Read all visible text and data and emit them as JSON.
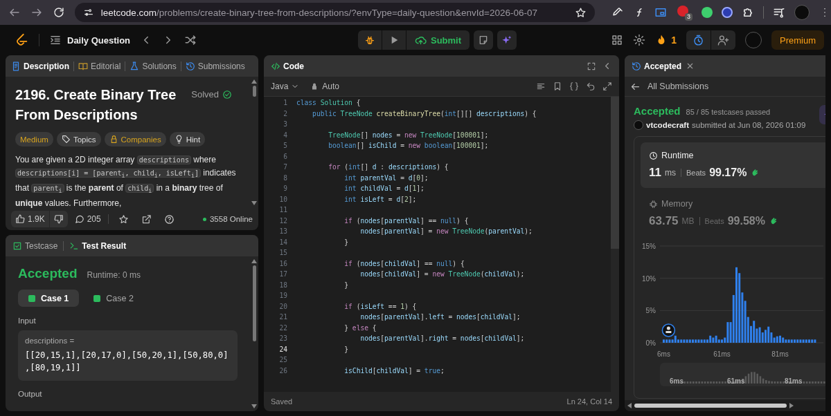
{
  "browser": {
    "url_host": "leetcode.com",
    "url_path": "/problems/create-binary-tree-from-descriptions/?envType=daily-question&envId=2026-06-07",
    "extension_badge": "3"
  },
  "header": {
    "title": "Daily Question",
    "submit": "Submit",
    "streak": "1",
    "premium": "Premium"
  },
  "description_panel": {
    "tabs": [
      {
        "label": "Description",
        "selected": true,
        "kind": "description"
      },
      {
        "label": "Editorial",
        "selected": false,
        "kind": "editorial"
      },
      {
        "label": "Solutions",
        "selected": false,
        "kind": "solutions"
      },
      {
        "label": "Submissions",
        "selected": false,
        "kind": "submissions"
      }
    ],
    "title": "2196. Create Binary Tree From Descriptions",
    "status": "Solved",
    "tags": [
      {
        "label": "Medium",
        "kind": "difficulty"
      },
      {
        "label": "Topics",
        "kind": "topics"
      },
      {
        "label": "Companies",
        "kind": "companies"
      },
      {
        "label": "Hint",
        "kind": "hint"
      }
    ],
    "body": [
      {
        "kind": "text",
        "text": "You are given a 2D integer array "
      },
      {
        "kind": "code",
        "text": "descriptions"
      },
      {
        "kind": "text",
        "text": " where "
      },
      {
        "kind": "code",
        "text": "descriptions[i] = [parent$_{i}$, child$_{i}$, isLeft$_{i}$]"
      },
      {
        "kind": "text",
        "text": " indicates that "
      },
      {
        "kind": "code",
        "text": "parent$_{i}$"
      },
      {
        "kind": "text",
        "text": " is the **parent** of "
      },
      {
        "kind": "code",
        "text": "child$_{i}$"
      },
      {
        "kind": "text",
        "text": " in a **binary** tree of **unique** values. Furthermore,"
      }
    ],
    "likes": "1.9K",
    "comments": "205",
    "online": "3558 Online"
  },
  "test_panel": {
    "tabs": [
      {
        "label": "Testcase",
        "selected": false,
        "kind": "testcase"
      },
      {
        "label": "Test Result",
        "selected": true,
        "kind": "result"
      }
    ],
    "verdict": "Accepted",
    "runtime": "Runtime: 0 ms",
    "cases": [
      {
        "label": "Case 1",
        "selected": true
      },
      {
        "label": "Case 2",
        "selected": false
      }
    ],
    "input_label": "Input",
    "input_name": "descriptions =",
    "input_value": "[[20,15,1],[20,17,0],[50,20,1],[50,80,0],[80,19,1]]",
    "output_label": "Output"
  },
  "code_panel": {
    "title": "Code",
    "language": "Java",
    "mode": "Auto",
    "status": "Saved",
    "cursor": "Ln 24, Col 14",
    "lines": [
      {
        "number": "1",
        "current": false,
        "tokens": [
          {
            "kind": "keyword",
            "text": "class"
          },
          {
            "kind": "type",
            "text": " Solution"
          },
          {
            "kind": "plain",
            "text": " {"
          }
        ]
      },
      {
        "number": "2",
        "current": false,
        "tokens": [
          {
            "kind": "keyword",
            "text": "    public"
          },
          {
            "kind": "type",
            "text": " TreeNode"
          },
          {
            "kind": "function",
            "text": " createBinaryTree"
          },
          {
            "kind": "plain",
            "text": "("
          },
          {
            "kind": "keyword",
            "text": "int"
          },
          {
            "kind": "plain",
            "text": "[][]"
          },
          {
            "kind": "variable",
            "text": " descriptions"
          },
          {
            "kind": "plain",
            "text": ") {"
          }
        ]
      },
      {
        "number": "3",
        "current": false
      },
      {
        "number": "4",
        "current": false,
        "tokens": [
          {
            "kind": "type",
            "text": "        TreeNode"
          },
          {
            "kind": "plain",
            "text": "[]"
          },
          {
            "kind": "variable",
            "text": " nodes"
          },
          {
            "kind": "plain",
            "text": " ="
          },
          {
            "kind": "control",
            "text": " new"
          },
          {
            "kind": "type",
            "text": " TreeNode"
          },
          {
            "kind": "plain",
            "text": "["
          },
          {
            "kind": "number",
            "text": "100001"
          },
          {
            "kind": "plain",
            "text": "];"
          }
        ]
      },
      {
        "number": "5",
        "current": false,
        "tokens": [
          {
            "kind": "keyword",
            "text": "        boolean"
          },
          {
            "kind": "plain",
            "text": "[]"
          },
          {
            "kind": "variable",
            "text": " isChild"
          },
          {
            "kind": "plain",
            "text": " ="
          },
          {
            "kind": "control",
            "text": " new"
          },
          {
            "kind": "keyword",
            "text": " boolean"
          },
          {
            "kind": "plain",
            "text": "["
          },
          {
            "kind": "number",
            "text": "100001"
          },
          {
            "kind": "plain",
            "text": "];"
          }
        ]
      },
      {
        "number": "6",
        "current": false
      },
      {
        "number": "7",
        "current": false,
        "tokens": [
          {
            "kind": "control",
            "text": "        for"
          },
          {
            "kind": "plain",
            "text": " ("
          },
          {
            "kind": "keyword",
            "text": "int"
          },
          {
            "kind": "plain",
            "text": "[]"
          },
          {
            "kind": "variable",
            "text": " d"
          },
          {
            "kind": "plain",
            "text": " :"
          },
          {
            "kind": "variable",
            "text": " descriptions"
          },
          {
            "kind": "plain",
            "text": ") {"
          }
        ]
      },
      {
        "number": "8",
        "current": false,
        "tokens": [
          {
            "kind": "keyword",
            "text": "            int"
          },
          {
            "kind": "variable",
            "text": " parentVal"
          },
          {
            "kind": "plain",
            "text": " ="
          },
          {
            "kind": "variable",
            "text": " d"
          },
          {
            "kind": "plain",
            "text": "["
          },
          {
            "kind": "number",
            "text": "0"
          },
          {
            "kind": "plain",
            "text": "];"
          }
        ]
      },
      {
        "number": "9",
        "current": false,
        "tokens": [
          {
            "kind": "keyword",
            "text": "            int"
          },
          {
            "kind": "variable",
            "text": " childVal"
          },
          {
            "kind": "plain",
            "text": " ="
          },
          {
            "kind": "variable",
            "text": " d"
          },
          {
            "kind": "plain",
            "text": "["
          },
          {
            "kind": "number",
            "text": "1"
          },
          {
            "kind": "plain",
            "text": "];"
          }
        ]
      },
      {
        "number": "10",
        "current": false,
        "tokens": [
          {
            "kind": "keyword",
            "text": "            int"
          },
          {
            "kind": "variable",
            "text": " isLeft"
          },
          {
            "kind": "plain",
            "text": " ="
          },
          {
            "kind": "variable",
            "text": " d"
          },
          {
            "kind": "plain",
            "text": "["
          },
          {
            "kind": "number",
            "text": "2"
          },
          {
            "kind": "plain",
            "text": "];"
          }
        ]
      },
      {
        "number": "11",
        "current": false
      },
      {
        "number": "12",
        "current": false,
        "tokens": [
          {
            "kind": "control",
            "text": "            if"
          },
          {
            "kind": "plain",
            "text": " ("
          },
          {
            "kind": "variable",
            "text": "nodes"
          },
          {
            "kind": "plain",
            "text": "["
          },
          {
            "kind": "variable",
            "text": "parentVal"
          },
          {
            "kind": "plain",
            "text": "] =="
          },
          {
            "kind": "keyword",
            "text": " null"
          },
          {
            "kind": "plain",
            "text": ") {"
          }
        ]
      },
      {
        "number": "13",
        "current": false,
        "tokens": [
          {
            "kind": "variable",
            "text": "                nodes"
          },
          {
            "kind": "plain",
            "text": "["
          },
          {
            "kind": "variable",
            "text": "parentVal"
          },
          {
            "kind": "plain",
            "text": "] ="
          },
          {
            "kind": "control",
            "text": " new"
          },
          {
            "kind": "type",
            "text": " TreeNode"
          },
          {
            "kind": "plain",
            "text": "("
          },
          {
            "kind": "variable",
            "text": "parentVal"
          },
          {
            "kind": "plain",
            "text": ");"
          }
        ]
      },
      {
        "number": "14",
        "current": false,
        "tokens": [
          {
            "kind": "plain",
            "text": "            }"
          }
        ]
      },
      {
        "number": "15",
        "current": false
      },
      {
        "number": "16",
        "current": false,
        "tokens": [
          {
            "kind": "control",
            "text": "            if"
          },
          {
            "kind": "plain",
            "text": " ("
          },
          {
            "kind": "variable",
            "text": "nodes"
          },
          {
            "kind": "plain",
            "text": "["
          },
          {
            "kind": "variable",
            "text": "childVal"
          },
          {
            "kind": "plain",
            "text": "] =="
          },
          {
            "kind": "keyword",
            "text": " null"
          },
          {
            "kind": "plain",
            "text": ") {"
          }
        ]
      },
      {
        "number": "17",
        "current": false,
        "tokens": [
          {
            "kind": "variable",
            "text": "                nodes"
          },
          {
            "kind": "plain",
            "text": "["
          },
          {
            "kind": "variable",
            "text": "childVal"
          },
          {
            "kind": "plain",
            "text": "] ="
          },
          {
            "kind": "control",
            "text": " new"
          },
          {
            "kind": "type",
            "text": " TreeNode"
          },
          {
            "kind": "plain",
            "text": "("
          },
          {
            "kind": "variable",
            "text": "childVal"
          },
          {
            "kind": "plain",
            "text": ");"
          }
        ]
      },
      {
        "number": "18",
        "current": false,
        "tokens": [
          {
            "kind": "plain",
            "text": "            }"
          }
        ]
      },
      {
        "number": "19",
        "current": false
      },
      {
        "number": "20",
        "current": false,
        "tokens": [
          {
            "kind": "control",
            "text": "            if"
          },
          {
            "kind": "plain",
            "text": " ("
          },
          {
            "kind": "variable",
            "text": "isLeft"
          },
          {
            "kind": "plain",
            "text": " =="
          },
          {
            "kind": "number",
            "text": " 1"
          },
          {
            "kind": "plain",
            "text": ") {"
          }
        ]
      },
      {
        "number": "21",
        "current": false,
        "tokens": [
          {
            "kind": "variable",
            "text": "                nodes"
          },
          {
            "kind": "plain",
            "text": "["
          },
          {
            "kind": "variable",
            "text": "parentVal"
          },
          {
            "kind": "plain",
            "text": "]."
          },
          {
            "kind": "variable",
            "text": "left"
          },
          {
            "kind": "plain",
            "text": " ="
          },
          {
            "kind": "variable",
            "text": " nodes"
          },
          {
            "kind": "plain",
            "text": "["
          },
          {
            "kind": "variable",
            "text": "childVal"
          },
          {
            "kind": "plain",
            "text": "];"
          }
        ]
      },
      {
        "number": "22",
        "current": false,
        "tokens": [
          {
            "kind": "plain",
            "text": "            }"
          },
          {
            "kind": "control",
            "text": " else"
          },
          {
            "kind": "plain",
            "text": " {"
          }
        ]
      },
      {
        "number": "23",
        "current": false,
        "tokens": [
          {
            "kind": "variable",
            "text": "                nodes"
          },
          {
            "kind": "plain",
            "text": "["
          },
          {
            "kind": "variable",
            "text": "parentVal"
          },
          {
            "kind": "plain",
            "text": "]."
          },
          {
            "kind": "variable",
            "text": "right"
          },
          {
            "kind": "plain",
            "text": " ="
          },
          {
            "kind": "variable",
            "text": " nodes"
          },
          {
            "kind": "plain",
            "text": "["
          },
          {
            "kind": "variable",
            "text": "childVal"
          },
          {
            "kind": "plain",
            "text": "];"
          }
        ]
      },
      {
        "number": "24",
        "current": true,
        "tokens": [
          {
            "kind": "plain",
            "text": "            }"
          }
        ]
      },
      {
        "number": "25",
        "current": false
      },
      {
        "number": "26",
        "current": false,
        "tokens": [
          {
            "kind": "variable",
            "text": "            isChild"
          },
          {
            "kind": "plain",
            "text": "["
          },
          {
            "kind": "variable",
            "text": "childVal"
          },
          {
            "kind": "plain",
            "text": "] ="
          },
          {
            "kind": "keyword",
            "text": " true"
          },
          {
            "kind": "plain",
            "text": ";"
          }
        ]
      }
    ]
  },
  "submission_panel": {
    "tab": "Accepted",
    "back": "All Submissions",
    "verdict": "Accepted",
    "testcases": "85 / 85 testcases passed",
    "user": "vtcodecraft",
    "submitted": "submitted at Jun 08, 2026 01:09",
    "metrics": [
      {
        "kind": "runtime",
        "label": "Runtime",
        "value": "11",
        "unit": "ms",
        "beats_label": "Beats",
        "beats": "99.17%",
        "selected": true
      },
      {
        "kind": "memory",
        "label": "Memory",
        "value": "63.75",
        "unit": "MB",
        "beats_label": "Beats",
        "beats": "99.58%",
        "selected": false
      }
    ],
    "chart_data": {
      "type": "bar",
      "ylim": [
        0,
        15
      ],
      "yticks": [
        {
          "value": 0,
          "label": "0%"
        },
        {
          "value": 5,
          "label": "5%"
        },
        {
          "value": 10,
          "label": "10%"
        },
        {
          "value": 15,
          "label": "15%"
        }
      ],
      "categories": [
        "6ms",
        null,
        null,
        null,
        null,
        null,
        null,
        null,
        null,
        null,
        null,
        null,
        null,
        null,
        null,
        null,
        null,
        null,
        null,
        null,
        "61ms",
        null,
        null,
        null,
        null,
        null,
        null,
        null,
        null,
        null,
        null,
        null,
        null,
        null,
        null,
        null,
        null,
        null,
        null,
        null,
        "81ms",
        null,
        null,
        null,
        null,
        null,
        null,
        null,
        null,
        null,
        null,
        null,
        null
      ],
      "values": [
        0.5,
        0.5,
        0.5,
        0.5,
        1.1,
        0.5,
        0.5,
        0.5,
        0.5,
        0.5,
        0.5,
        0.5,
        0.5,
        0.5,
        0.5,
        0.5,
        1.1,
        0.8,
        1.1,
        0.5,
        0.5,
        0.8,
        3.2,
        3.2,
        7.4,
        11.7,
        10.8,
        7.8,
        6.5,
        4.0,
        2.6,
        3.4,
        2.2,
        2.4,
        1.6,
        2.0,
        2.5,
        1.6,
        0.8,
        1.0,
        1.1,
        0.8,
        0.5,
        0.5,
        0.5,
        0.5,
        0.5,
        0.5,
        0.5,
        0.5,
        0.5,
        0.5,
        0.5
      ]
    },
    "overview_labels": [
      "6ms",
      "61ms",
      "81ms"
    ]
  }
}
